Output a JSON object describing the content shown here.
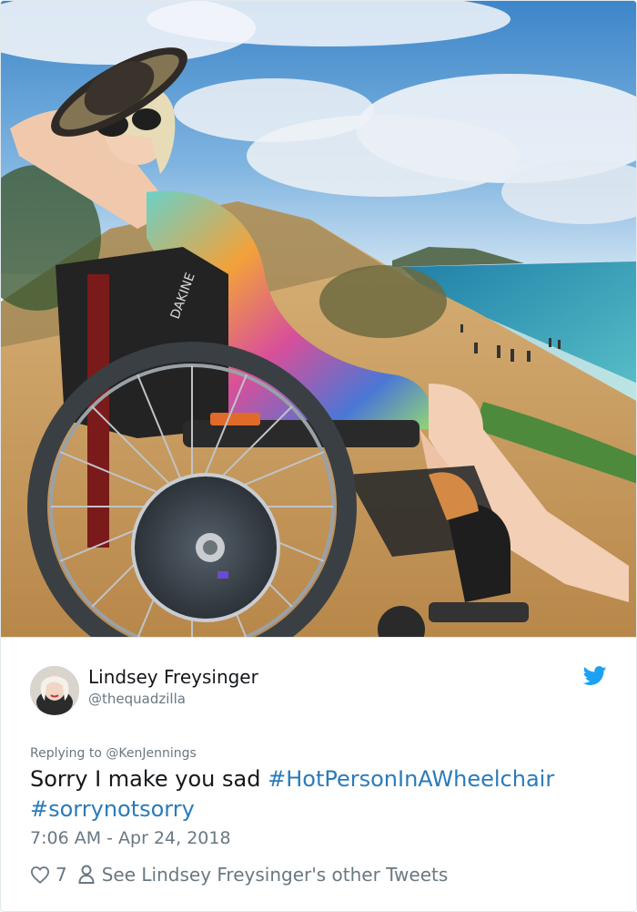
{
  "tweet": {
    "author_name": "Lindsey Freysinger",
    "author_handle": "@thequadzilla",
    "replying_prefix": "Replying to",
    "replying_to": "@KenJennings",
    "text_plain": "Sorry I make you sad",
    "hashtag_1": "#HotPersonInAWheelchair",
    "hashtag_2": "#sorrynotsorry",
    "timestamp": "7:06 AM - Apr 24, 2018",
    "likes": "7",
    "see_more": "See Lindsey Freysinger's other Tweets"
  },
  "photo": {
    "wheelchair_brand": "DAKINE"
  },
  "colors": {
    "link": "#2b7bb9",
    "twitter_blue": "#1da1f2",
    "muted": "#697882",
    "text": "#14171a",
    "border": "#e1e8ed"
  },
  "icons": {
    "brand": "twitter-bird-icon",
    "like": "heart-icon",
    "profile": "person-icon"
  }
}
